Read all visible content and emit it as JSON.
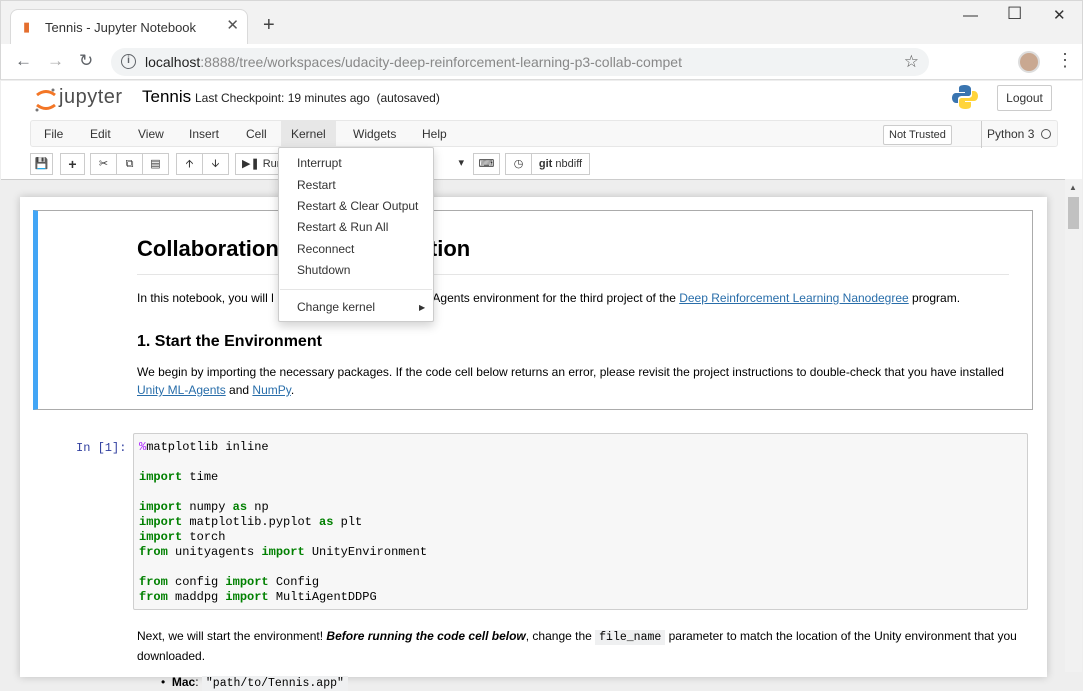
{
  "browser": {
    "tab_title": "Tennis - Jupyter Notebook",
    "url_host": "localhost",
    "url_rest": ":8888/tree/workspaces/udacity-deep-reinforcement-learning-p3-collab-compet"
  },
  "header": {
    "logo_text": "jupyter",
    "notebook_title": "Tennis",
    "checkpoint": "Last Checkpoint: 19 minutes ago",
    "autosave": "(autosaved)",
    "logout_label": "Logout"
  },
  "menubar": {
    "items": [
      "File",
      "Edit",
      "View",
      "Insert",
      "Cell",
      "Kernel",
      "Widgets",
      "Help"
    ],
    "trusted": "Not Trusted",
    "kernel": "Python 3"
  },
  "toolbar": {
    "run_label": "Run",
    "nbdiff_label": "nbdiff",
    "git_label": "git"
  },
  "kernel_menu": {
    "items": [
      "Interrupt",
      "Restart",
      "Restart & Clear Output",
      "Restart & Run All",
      "Reconnect",
      "Shutdown"
    ],
    "change_kernel": "Change kernel"
  },
  "notebook": {
    "heading": "Collaboration and Competition",
    "heading_visible_left": "Collaboration",
    "heading_visible_right": "ition",
    "intro_left": "In this notebook, you will l",
    "intro_mid": "ML-Agents environment for the third project of the ",
    "intro_link": "Deep Reinforcement Learning Nanodegree",
    "intro_end": " program.",
    "section1": "1. Start the Environment",
    "p2_text": "We begin by importing the necessary packages. If the code cell below returns an error, please revisit the project instructions to double-check that you have installed ",
    "p2_link1": "Unity ML-Agents",
    "p2_and": " and ",
    "p2_link2": "NumPy",
    "p2_end": ".",
    "prompt": "In [1]:",
    "p3_a": "Next, we will start the environment! ",
    "p3_b": "Before running the code cell below",
    "p3_c": ", change the ",
    "p3_code": "file_name",
    "p3_d": " parameter to match the location of the Unity environment that you downloaded.",
    "li_label": "Mac",
    "li_code": "\"path/to/Tennis.app\""
  },
  "colors": {
    "accent_cell": "#42a5f5",
    "link": "#296eaa",
    "keyword": "#008000",
    "magic": "#aa22ff"
  }
}
